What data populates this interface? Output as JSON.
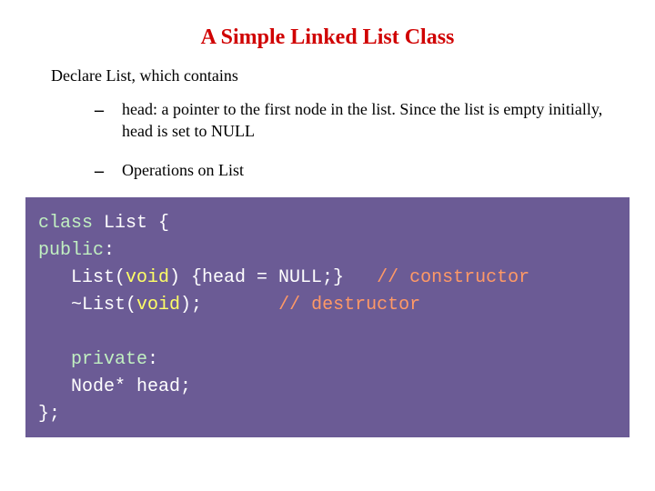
{
  "title": "A Simple Linked List Class",
  "lead": "Declare List, which contains",
  "bullets": [
    "head: a pointer to the first node in the list.\nSince the list is empty initially, head is set to NULL",
    "Operations on List"
  ],
  "code": {
    "l1a": "class",
    "l1b": " List {",
    "l2a": "public",
    "l2b": ":",
    "l3a": "   List(",
    "l3b": "void",
    "l3c": ") {head = NULL;}   ",
    "l3d": "// constructor",
    "l4a": "   ~List(",
    "l4b": "void",
    "l4c": ");       ",
    "l4d": "// destructor",
    "l5": "",
    "l6a": "   private",
    "l6b": ":",
    "l7": "   Node* head;",
    "l8": "};"
  }
}
